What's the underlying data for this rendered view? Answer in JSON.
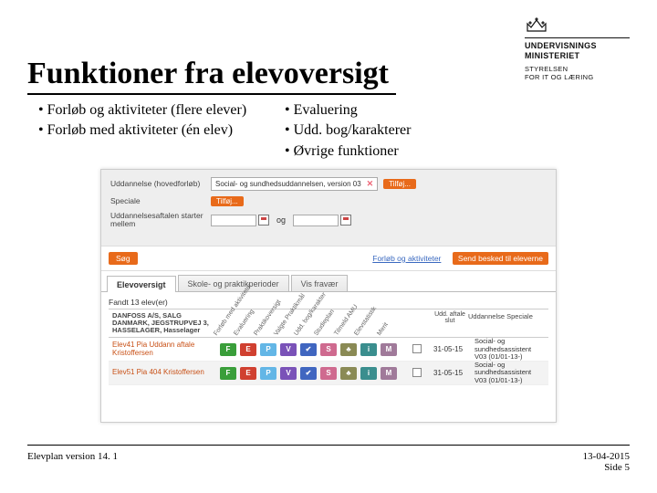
{
  "logo": {
    "line1": "UNDERVISNINGS",
    "line2": "MINISTERIET",
    "sub1": "STYRELSEN",
    "sub2": "FOR IT OG LÆRING"
  },
  "title": "Funktioner fra elevoversigt",
  "bullets_left": [
    "Forløb og aktiviteter (flere elever)",
    "Forløb med aktiviteter (én elev)"
  ],
  "bullets_right": [
    "Evaluering",
    "Udd. bog/karakterer",
    "Øvrige funktioner"
  ],
  "form": {
    "udd_label": "Uddannelse (hovedforløb)",
    "udd_value": "Social- og sundhedsuddannelsen, version 03",
    "speciale_label": "Speciale",
    "date_label": "Uddannelsesaftalen starter mellem",
    "date_join": "og",
    "tilfoj": "Tilføj..."
  },
  "searchbar": {
    "sog": "Søg",
    "link": "Forløb og aktiviteter",
    "send": "Send besked til eleverne"
  },
  "tabs": [
    "Elevoversigt",
    "Skole- og praktikperioder",
    "Vis fravær"
  ],
  "results": {
    "fandt": "Fandt 13 elev(er)",
    "company": "DANFOSS A/S, SALG DANMARK, JEGSTRUPVEJ 3, HASSELAGER, Hasselager",
    "diag_headers": [
      "Forløb med aktiviteter",
      "Evaluering",
      "Praktikoversigt",
      "Valgte Praktikmål",
      "Udd. bog/karakter",
      "Studieplan",
      "Tilmeld AMU",
      "Elevstatistik",
      "Merit"
    ],
    "col_udd_label": "Udd. aftale slut",
    "col_speciale_label": "Uddannelse Speciale",
    "rows": [
      {
        "name": "Elev41 Pia Uddann aftale Kristoffersen",
        "date": "31-05-15",
        "udd": "Social- og sundhedsassistent V03 (01/01-13-)"
      },
      {
        "name": "Elev51 Pia 404 Kristoffersen",
        "date": "31-05-15",
        "udd": "Social- og sundhedsassistent V03 (01/01-13-)"
      }
    ]
  },
  "icons": [
    {
      "t": "F",
      "c": "c-green"
    },
    {
      "t": "E",
      "c": "c-red"
    },
    {
      "t": "P",
      "c": "c-sky"
    },
    {
      "t": "V",
      "c": "c-purple"
    },
    {
      "t": "✔",
      "c": "c-blue"
    },
    {
      "t": "S",
      "c": "c-rose"
    },
    {
      "t": "♣",
      "c": "c-olive"
    },
    {
      "t": "i",
      "c": "c-teal"
    },
    {
      "t": "M",
      "c": "c-mauve"
    }
  ],
  "footer": {
    "left": "Elevplan version 14. 1",
    "date": "13-04-2015",
    "page": "Side 5"
  }
}
